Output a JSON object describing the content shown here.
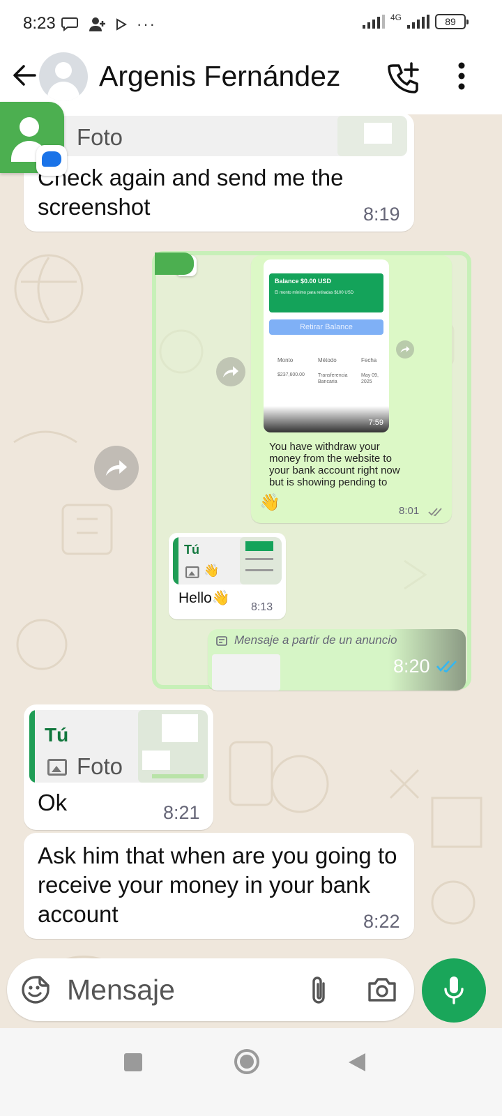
{
  "status_bar": {
    "time": "8:23",
    "dots": "···",
    "network": "4G",
    "battery": "89"
  },
  "header": {
    "contact_name": "Argenis Fernández",
    "icons": [
      "back-arrow-icon",
      "avatar",
      "add-call-icon",
      "more-vert-icon"
    ]
  },
  "messages": [
    {
      "direction": "incoming",
      "quote": {
        "label": "Foto"
      },
      "text": "Check again and send me the screenshot",
      "time": "8:19"
    },
    {
      "direction": "incoming-image",
      "screenshot": {
        "balance_title": "Balance $0.00 USD",
        "balance_note": "El monto mínimo para retiradas $100 USD",
        "withdraw_button": "Retirar Balance",
        "table_headers": [
          "Monto",
          "Método",
          "Fecha"
        ],
        "table_row": [
          "$237,600.00",
          "Transferencia Bancaria",
          "May 09, 2025"
        ],
        "image_time": "7:59",
        "inner_text": "You have withdraw your money from the website to your bank account right now but is showing pending to your bank",
        "inner_emoji": "👋",
        "inner_time": "8:01",
        "reply_quote_who": "Tú",
        "reply_text": "Hello👋",
        "reply_time": "8:13",
        "ad_label": "Mensaje a partir de un anuncio",
        "ad_time": "8:20"
      }
    },
    {
      "direction": "incoming",
      "quote": {
        "who": "Tú",
        "label": "Foto"
      },
      "text": "Ok",
      "time": "8:21"
    },
    {
      "direction": "incoming",
      "text": "Ask him that when are you going to receive your money in your bank account",
      "time": "8:22"
    }
  ],
  "input": {
    "placeholder": "Mensaje"
  },
  "colors": {
    "accent": "#1aa65a",
    "chat_bg": "#efe7dc",
    "outgoing_bubble": "#dcf8c6"
  }
}
